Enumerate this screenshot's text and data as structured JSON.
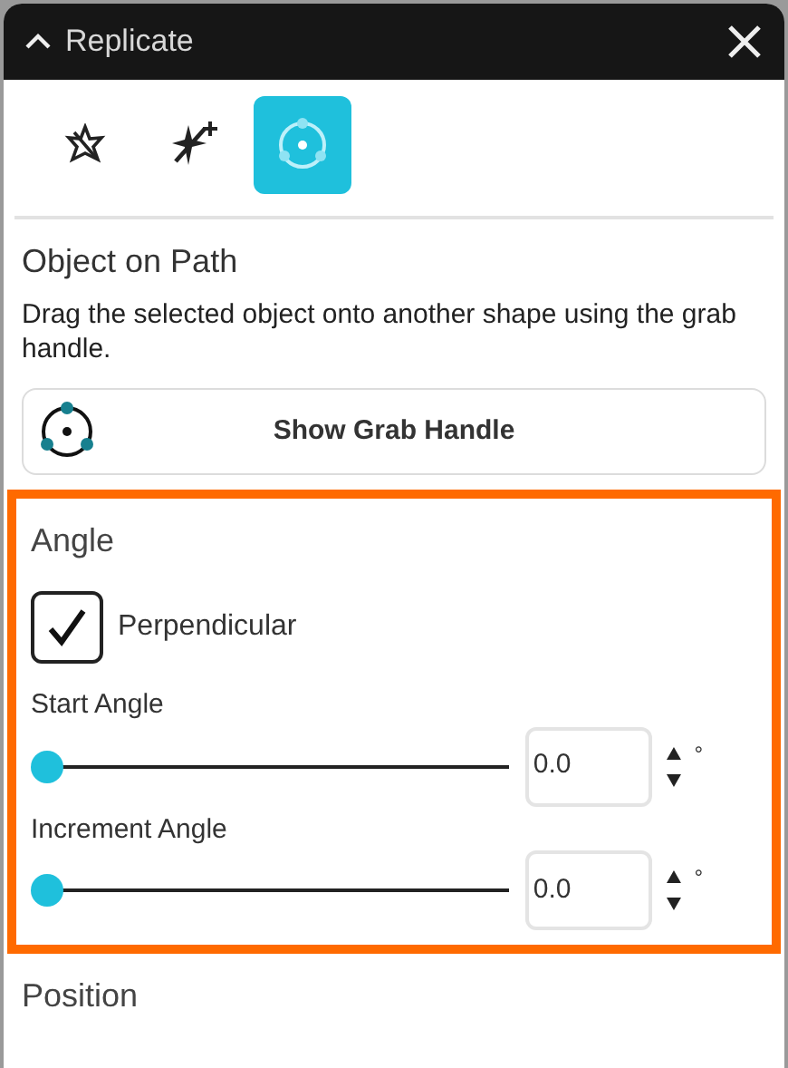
{
  "window": {
    "title": "Replicate"
  },
  "tools": [
    {
      "kind": "star",
      "selected": false
    },
    {
      "kind": "sparkle",
      "selected": false
    },
    {
      "kind": "path",
      "selected": true
    }
  ],
  "section": {
    "title": "Object on Path",
    "description": "Drag the selected object onto another shape using the grab handle.",
    "button": "Show Grab Handle"
  },
  "angle": {
    "title": "Angle",
    "perpendicular": {
      "label": "Perpendicular",
      "checked": true
    },
    "sliders": [
      {
        "label": "Start Angle",
        "level": 0,
        "value": "0.0",
        "unit": "°"
      },
      {
        "label": "Increment Angle",
        "level": 0,
        "value": "0.0",
        "unit": "°"
      }
    ]
  },
  "next_section": {
    "title": "Position"
  }
}
